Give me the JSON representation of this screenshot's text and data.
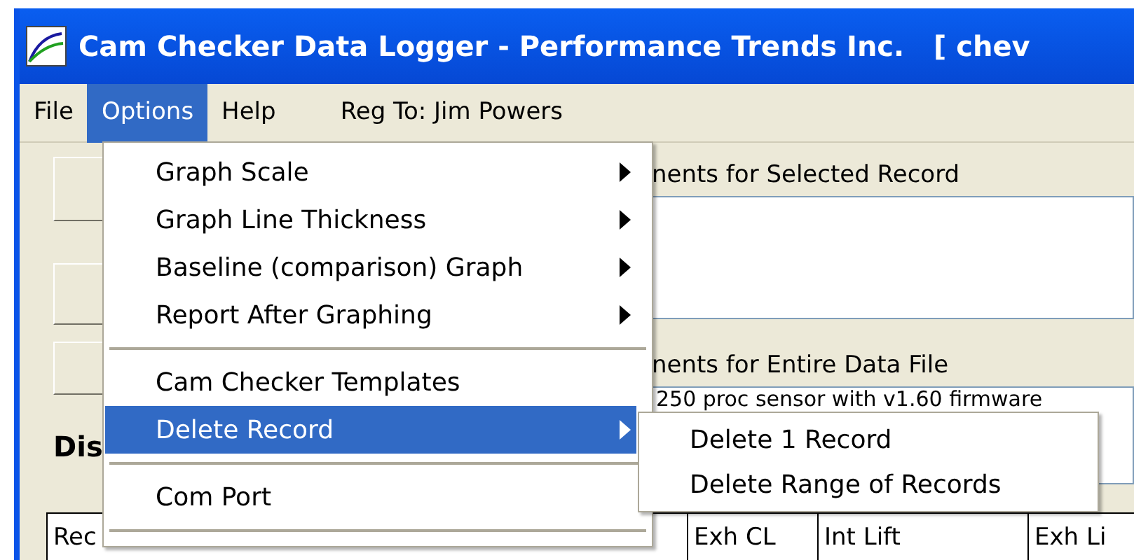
{
  "window": {
    "title": "Cam Checker Data Logger - Performance Trends Inc.   [ chev"
  },
  "menu_bar": [
    {
      "label": "File",
      "selected": false
    },
    {
      "label": "Options",
      "selected": true
    },
    {
      "label": "Help",
      "selected": false
    }
  ],
  "registration": "Reg To: Jim Powers",
  "panels": [
    {
      "title": "nents for Selected Record"
    },
    {
      "title": "nents for Entire Data File",
      "text": "250 proc sensor with v1.60 firmware"
    }
  ],
  "display_label": "Dis",
  "table": {
    "columns": [
      "Rec",
      "Exh CL",
      "Int Lift",
      "Exh Li"
    ]
  },
  "options_menu": {
    "items": [
      {
        "kind": "item",
        "label": "Graph Scale",
        "submenu": true,
        "selected": false
      },
      {
        "kind": "item",
        "label": "Graph Line Thickness",
        "submenu": true,
        "selected": false
      },
      {
        "kind": "item",
        "label": "Baseline (comparison) Graph",
        "submenu": true,
        "selected": false
      },
      {
        "kind": "item",
        "label": "Report After Graphing",
        "submenu": true,
        "selected": false
      },
      {
        "kind": "separator"
      },
      {
        "kind": "item",
        "label": "Cam Checker Templates",
        "submenu": false,
        "selected": false
      },
      {
        "kind": "item",
        "label": "Delete Record",
        "submenu": true,
        "selected": true
      },
      {
        "kind": "separator"
      },
      {
        "kind": "item",
        "label": "Com Port",
        "submenu": false,
        "selected": false
      },
      {
        "kind": "separator"
      }
    ]
  },
  "submenu": {
    "items": [
      {
        "label": "Delete 1 Record"
      },
      {
        "label": "Delete Range of Records"
      }
    ]
  }
}
